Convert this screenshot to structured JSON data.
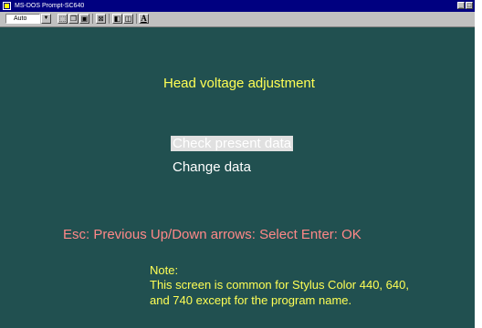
{
  "window": {
    "title": "MS-DOS Prompt-SC640",
    "controls": {
      "minimize": "_",
      "restore": "□"
    }
  },
  "toolbar": {
    "font_size": "Auto",
    "tools": [
      "mark-icon",
      "copy-icon",
      "paste-icon",
      "fullscreen-icon",
      "properties-icon",
      "background-icon"
    ],
    "font_button": "A"
  },
  "screen": {
    "heading": "Head voltage adjustment",
    "menu": [
      "Check present data",
      "Change data"
    ],
    "selected_index": 0,
    "keys_help": "Esc: Previous  Up/Down arrows: Select  Enter: OK",
    "note_label": "Note:",
    "note_line1": "This screen is common for Stylus Color 440, 640,",
    "note_line2": "and 740 except for the program name.",
    "colors": {
      "background": "#215050",
      "heading": "#ffff55",
      "menu": "#ffffff",
      "keys": "#ff8888",
      "note": "#ffff55"
    }
  }
}
